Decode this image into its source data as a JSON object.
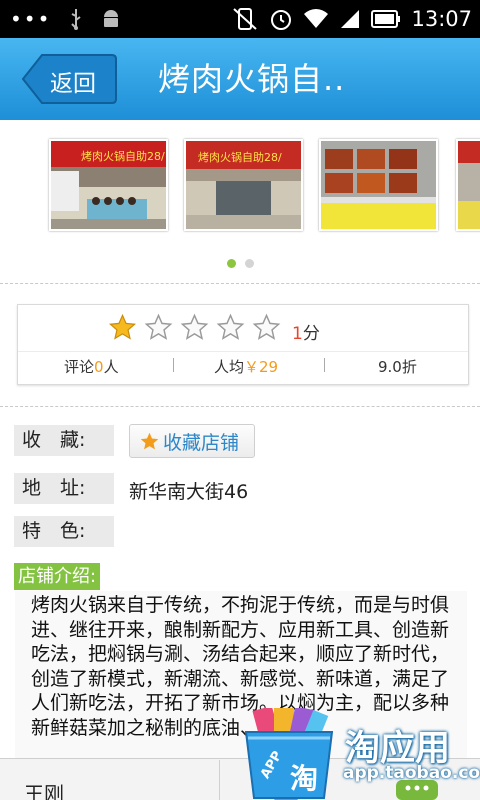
{
  "status_bar": {
    "time": "13:07",
    "left_icons": [
      "more-dots-icon",
      "usb-icon",
      "android-icon"
    ],
    "right_icons": [
      "vibrate-off-icon",
      "alarm-icon",
      "wifi-icon",
      "signal-icon",
      "battery-icon"
    ]
  },
  "header": {
    "back_label": "返回",
    "title": "烤肉火锅自..",
    "color": "#2a9ee6"
  },
  "gallery": {
    "photos": [
      {
        "sign": "烤肉火锅自助28/"
      },
      {
        "sign": "烤肉火锅自助28/"
      },
      {
        "sign": ""
      },
      {
        "sign": ""
      }
    ],
    "page_count": 2,
    "active_page": 1
  },
  "rating": {
    "stars": 1,
    "max_stars": 5,
    "score_value": "1",
    "score_unit": "分",
    "reviews_label": "评论",
    "reviews_count": "0",
    "reviews_unit": "人",
    "avg_label": "人均",
    "avg_value": "￥29",
    "discount": "9.0折"
  },
  "info": {
    "favorite_label": "收　藏:",
    "favorite_button": "收藏店铺",
    "address_label": "地　址:",
    "address_value": "新华南大街46",
    "feature_label": "特　色:",
    "intro_tag": "店铺介绍:",
    "intro_text": "烤肉火锅来自于传统，不拘泥于传统，而是与时俱进、继往开来，酿制新配方、应用新工具、创造新吃法，把焖锅与涮、汤结合起来，顺应了新时代，创造了新模式，新潮流、新感觉、新味道，满足了人们新吃法，开拓了新市场。以焖为主，配以多种新鲜菇菜加之秘制的底油、酱汁"
  },
  "bottom": {
    "name": "王刚"
  },
  "watermark": {
    "title": "淘应用",
    "url": "app.taobao.com",
    "bag_label": "APP",
    "bag_char": "淘"
  },
  "colors": {
    "accent_green": "#84c341",
    "price_orange": "#f39c1c",
    "score_red": "#e8432d",
    "link_blue": "#2d87c9"
  }
}
